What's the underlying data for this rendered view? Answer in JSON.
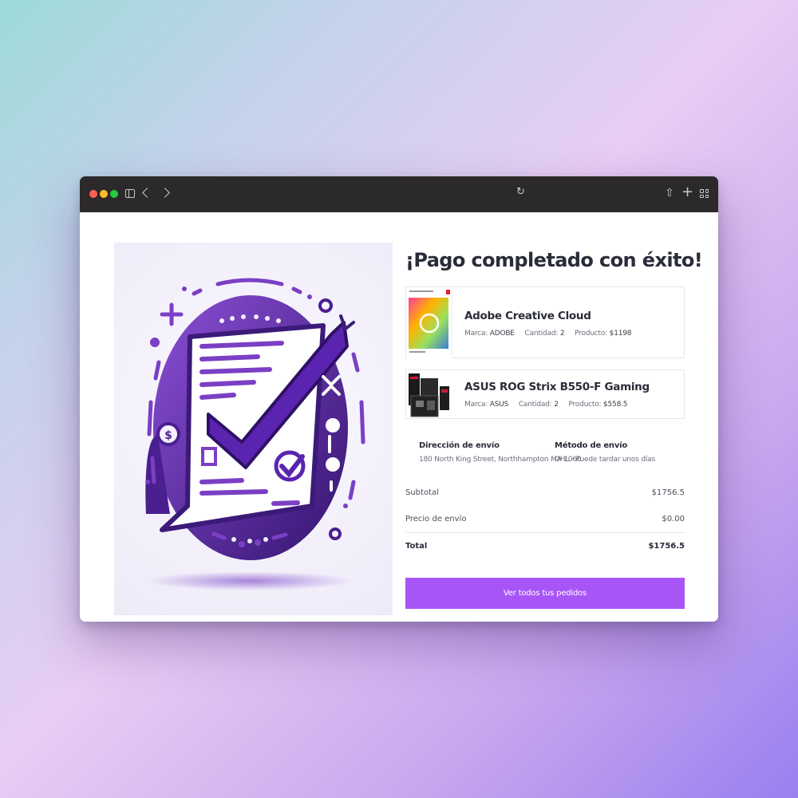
{
  "browser": {
    "title": "",
    "toolbar_icons": [
      "sidebar-icon",
      "back-icon",
      "forward-icon",
      "reload-icon",
      "share-icon",
      "new-tab-icon",
      "tab-overview-icon"
    ]
  },
  "order": {
    "heading": "¡Pago completado con éxito!",
    "products": [
      {
        "name": "Adobe Creative Cloud",
        "brand_label": "Marca:",
        "brand": "ADOBE",
        "qty_label": "Cantidad:",
        "qty": "2",
        "price_label": "Producto:",
        "price": "$1198",
        "thumb_caption": "Adobe Creative Cloud"
      },
      {
        "name": "ASUS ROG Strix B550-F Gaming",
        "brand_label": "Marca:",
        "brand": "ASUS",
        "qty_label": "Cantidad:",
        "qty": "2",
        "price_label": "Producto:",
        "price": "$558.5"
      }
    ],
    "shipping": {
      "address_label": "Dirección de envío",
      "address": "180 North King Street, Northhampton MA 1060",
      "method_label": "Método de envío",
      "method": "DHL - Puede tardar unos días"
    },
    "summary": {
      "subtotal_label": "Subtotal",
      "subtotal": "$1756.5",
      "shipping_label": "Precio de envío",
      "shipping": "$0.00",
      "total_label": "Total",
      "total": "$1756.5"
    },
    "cta_label": "Ver todos tus pedidos"
  },
  "colors": {
    "accent": "#a855f7",
    "illustration_dark": "#3b1a78",
    "illustration_mid": "#7b3fc4",
    "titlebar": "#2b2929"
  }
}
